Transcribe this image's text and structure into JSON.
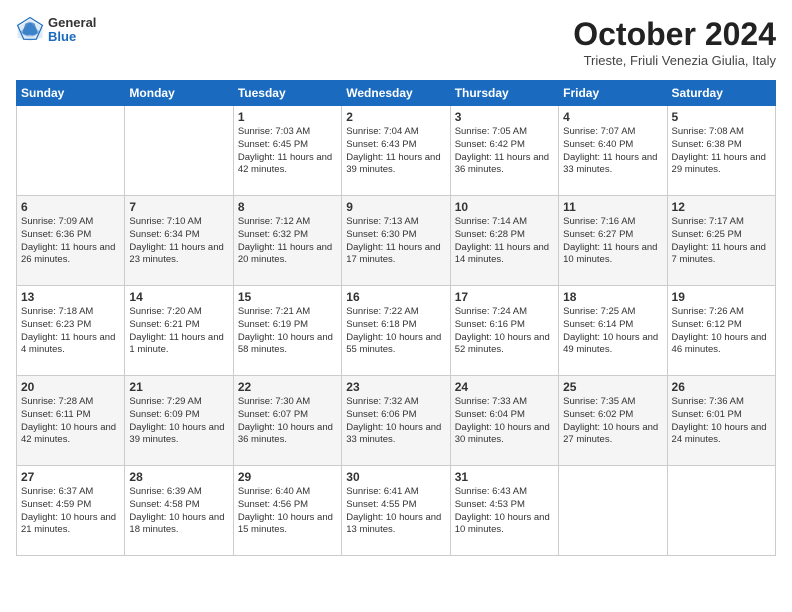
{
  "header": {
    "logo": {
      "general": "General",
      "blue": "Blue"
    },
    "title": "October 2024",
    "location": "Trieste, Friuli Venezia Giulia, Italy"
  },
  "weekdays": [
    "Sunday",
    "Monday",
    "Tuesday",
    "Wednesday",
    "Thursday",
    "Friday",
    "Saturday"
  ],
  "weeks": [
    [
      {
        "day": "",
        "info": ""
      },
      {
        "day": "",
        "info": ""
      },
      {
        "day": "1",
        "info": "Sunrise: 7:03 AM\nSunset: 6:45 PM\nDaylight: 11 hours and 42 minutes."
      },
      {
        "day": "2",
        "info": "Sunrise: 7:04 AM\nSunset: 6:43 PM\nDaylight: 11 hours and 39 minutes."
      },
      {
        "day": "3",
        "info": "Sunrise: 7:05 AM\nSunset: 6:42 PM\nDaylight: 11 hours and 36 minutes."
      },
      {
        "day": "4",
        "info": "Sunrise: 7:07 AM\nSunset: 6:40 PM\nDaylight: 11 hours and 33 minutes."
      },
      {
        "day": "5",
        "info": "Sunrise: 7:08 AM\nSunset: 6:38 PM\nDaylight: 11 hours and 29 minutes."
      }
    ],
    [
      {
        "day": "6",
        "info": "Sunrise: 7:09 AM\nSunset: 6:36 PM\nDaylight: 11 hours and 26 minutes."
      },
      {
        "day": "7",
        "info": "Sunrise: 7:10 AM\nSunset: 6:34 PM\nDaylight: 11 hours and 23 minutes."
      },
      {
        "day": "8",
        "info": "Sunrise: 7:12 AM\nSunset: 6:32 PM\nDaylight: 11 hours and 20 minutes."
      },
      {
        "day": "9",
        "info": "Sunrise: 7:13 AM\nSunset: 6:30 PM\nDaylight: 11 hours and 17 minutes."
      },
      {
        "day": "10",
        "info": "Sunrise: 7:14 AM\nSunset: 6:28 PM\nDaylight: 11 hours and 14 minutes."
      },
      {
        "day": "11",
        "info": "Sunrise: 7:16 AM\nSunset: 6:27 PM\nDaylight: 11 hours and 10 minutes."
      },
      {
        "day": "12",
        "info": "Sunrise: 7:17 AM\nSunset: 6:25 PM\nDaylight: 11 hours and 7 minutes."
      }
    ],
    [
      {
        "day": "13",
        "info": "Sunrise: 7:18 AM\nSunset: 6:23 PM\nDaylight: 11 hours and 4 minutes."
      },
      {
        "day": "14",
        "info": "Sunrise: 7:20 AM\nSunset: 6:21 PM\nDaylight: 11 hours and 1 minute."
      },
      {
        "day": "15",
        "info": "Sunrise: 7:21 AM\nSunset: 6:19 PM\nDaylight: 10 hours and 58 minutes."
      },
      {
        "day": "16",
        "info": "Sunrise: 7:22 AM\nSunset: 6:18 PM\nDaylight: 10 hours and 55 minutes."
      },
      {
        "day": "17",
        "info": "Sunrise: 7:24 AM\nSunset: 6:16 PM\nDaylight: 10 hours and 52 minutes."
      },
      {
        "day": "18",
        "info": "Sunrise: 7:25 AM\nSunset: 6:14 PM\nDaylight: 10 hours and 49 minutes."
      },
      {
        "day": "19",
        "info": "Sunrise: 7:26 AM\nSunset: 6:12 PM\nDaylight: 10 hours and 46 minutes."
      }
    ],
    [
      {
        "day": "20",
        "info": "Sunrise: 7:28 AM\nSunset: 6:11 PM\nDaylight: 10 hours and 42 minutes."
      },
      {
        "day": "21",
        "info": "Sunrise: 7:29 AM\nSunset: 6:09 PM\nDaylight: 10 hours and 39 minutes."
      },
      {
        "day": "22",
        "info": "Sunrise: 7:30 AM\nSunset: 6:07 PM\nDaylight: 10 hours and 36 minutes."
      },
      {
        "day": "23",
        "info": "Sunrise: 7:32 AM\nSunset: 6:06 PM\nDaylight: 10 hours and 33 minutes."
      },
      {
        "day": "24",
        "info": "Sunrise: 7:33 AM\nSunset: 6:04 PM\nDaylight: 10 hours and 30 minutes."
      },
      {
        "day": "25",
        "info": "Sunrise: 7:35 AM\nSunset: 6:02 PM\nDaylight: 10 hours and 27 minutes."
      },
      {
        "day": "26",
        "info": "Sunrise: 7:36 AM\nSunset: 6:01 PM\nDaylight: 10 hours and 24 minutes."
      }
    ],
    [
      {
        "day": "27",
        "info": "Sunrise: 6:37 AM\nSunset: 4:59 PM\nDaylight: 10 hours and 21 minutes."
      },
      {
        "day": "28",
        "info": "Sunrise: 6:39 AM\nSunset: 4:58 PM\nDaylight: 10 hours and 18 minutes."
      },
      {
        "day": "29",
        "info": "Sunrise: 6:40 AM\nSunset: 4:56 PM\nDaylight: 10 hours and 15 minutes."
      },
      {
        "day": "30",
        "info": "Sunrise: 6:41 AM\nSunset: 4:55 PM\nDaylight: 10 hours and 13 minutes."
      },
      {
        "day": "31",
        "info": "Sunrise: 6:43 AM\nSunset: 4:53 PM\nDaylight: 10 hours and 10 minutes."
      },
      {
        "day": "",
        "info": ""
      },
      {
        "day": "",
        "info": ""
      }
    ]
  ]
}
